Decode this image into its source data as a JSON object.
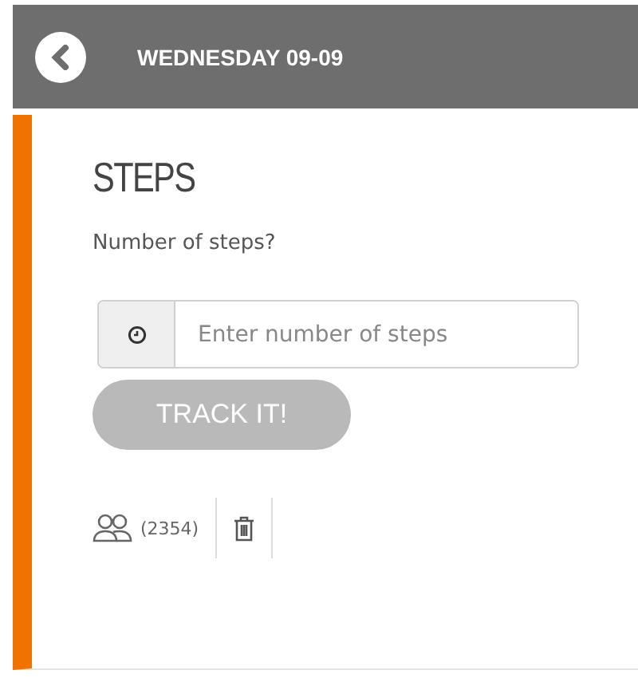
{
  "header": {
    "title": "WEDNESDAY 09-09"
  },
  "card": {
    "title": "STEPS",
    "question": "Number of steps?",
    "field": {
      "placeholder": "Enter number of steps"
    },
    "button": {
      "label": "TRACK IT!",
      "disabled": true
    },
    "actions": [
      {
        "kind": "people",
        "count": "(2354)"
      },
      {
        "kind": "delete"
      }
    ]
  }
}
